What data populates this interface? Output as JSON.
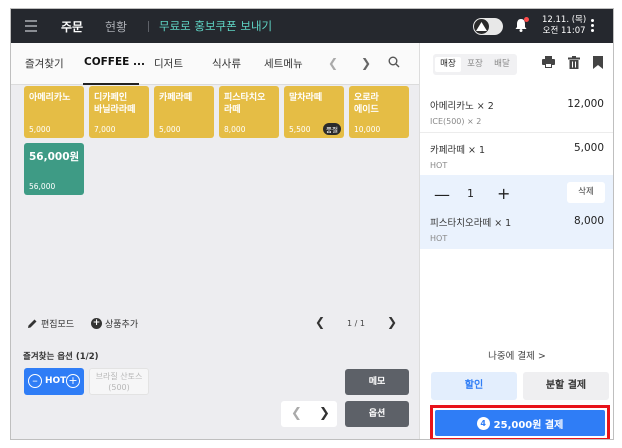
{
  "topbar": {
    "tab_order": "주문",
    "tab_status": "현황",
    "coupon_link": "무료로 홍보쿠폰 보내기",
    "date": "12.11. (목)",
    "time": "오전 11:07"
  },
  "categories": {
    "items": [
      "즐겨찾기",
      "COFFEE ...",
      "디저트",
      "식사류",
      "세트메뉴"
    ],
    "active_index": 1
  },
  "products": [
    {
      "name": "아메리카노",
      "price": "5,000",
      "badge": ""
    },
    {
      "name": "디카페인\n바닐라라떼",
      "price": "7,000",
      "badge": ""
    },
    {
      "name": "카페라떼",
      "price": "5,000",
      "badge": ""
    },
    {
      "name": "피스타치오\n라떼",
      "price": "8,000",
      "badge": ""
    },
    {
      "name": "말차라떼",
      "price": "5,500",
      "badge": "품절"
    },
    {
      "name": "오로라\n에이드",
      "price": "10,000",
      "badge": ""
    },
    {
      "name": "56,000원",
      "price": "56,000",
      "badge": ""
    }
  ],
  "toolbar": {
    "edit_mode": "편집모드",
    "add_product": "상품추가",
    "page": "1 / 1"
  },
  "favorite_options": {
    "label": "즐겨찾는 옵션 (1/2)",
    "hot": "HOT",
    "brazil_name": "브라질 산토스",
    "brazil_price": "(500)",
    "memo": "메모",
    "option": "옵션"
  },
  "panel": {
    "seg": [
      "매장",
      "포장",
      "배달"
    ],
    "items": [
      {
        "name": "아메리카노 × 2",
        "price": "12,000",
        "sub": "ICE(500) × 2"
      },
      {
        "name": "카페라떼 × 1",
        "price": "5,000",
        "sub": "HOT"
      },
      {
        "name": "피스타치오라떼 × 1",
        "price": "8,000",
        "sub": "HOT"
      }
    ],
    "qty": "1",
    "delete": "삭제",
    "later_pay": "나중에 결제 >",
    "discount": "할인",
    "split_pay": "분할 결제",
    "pay_count": "4",
    "pay_label": "25,000원 결제"
  },
  "colors": {
    "accent": "#2f7df6",
    "product_yellow": "#e5bd45",
    "product_green": "#3e9b85",
    "topbar": "#25282e",
    "highlight_border": "#e8131a"
  }
}
